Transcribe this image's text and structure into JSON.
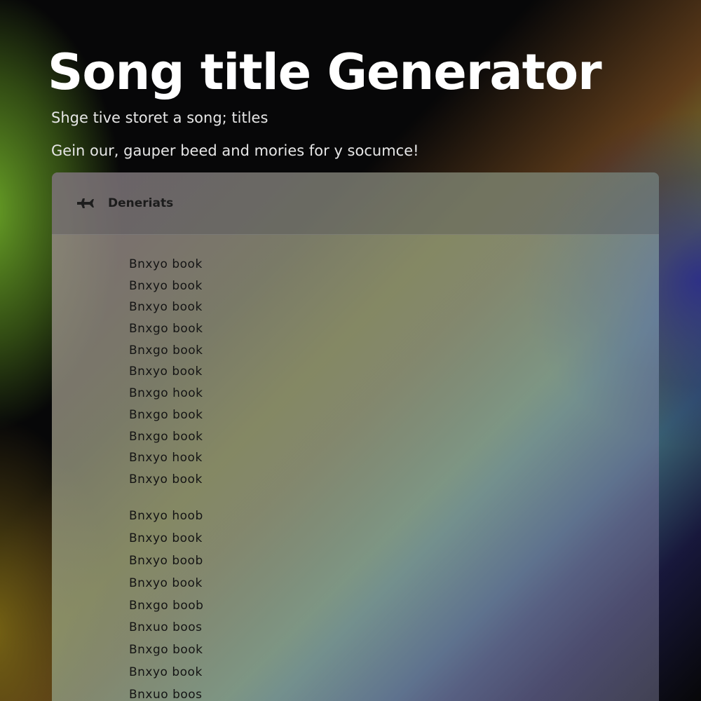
{
  "page": {
    "title": "Song title Generator",
    "subtitle": "Shge tive storet a song; titles",
    "tagline": "Gein our, gauper beed and mories for y socumce!"
  },
  "panel": {
    "header": {
      "icon": "airplane-icon",
      "label": "Deneriats"
    },
    "group_one": [
      "Bnxyo  book",
      "Bnxyo  book",
      "Bnxyo  book",
      "Bnxgo  book",
      "Bnxgo  book",
      "Bnxyo  book",
      "Bnxgo  hook",
      "Bnxgo  book",
      "Bnxgo  book",
      "Bnxyo  hook",
      "Bnxyo  book"
    ],
    "group_two": [
      "Bnxyo  hoob",
      "Bnxyo  book",
      "Bnxyo  boob",
      "Bnxyo  book",
      "Bnxgo  boob",
      "Bnxuo  boos",
      "Bnxgo  book",
      "Bnxyo  book",
      "Bnxuo  boos"
    ]
  },
  "colors": {
    "title": "#ffffff",
    "text": "#141414",
    "background": "#070708"
  }
}
